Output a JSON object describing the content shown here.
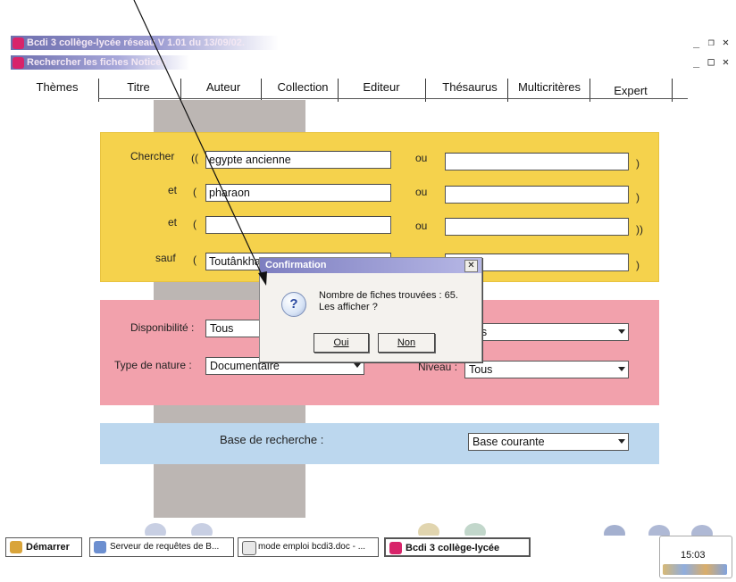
{
  "window": {
    "app_title": "Bcdi 3 collège-lycée réseau V 1.01 du 13/09/02.",
    "sub_title": "Rechercher les fiches Notices",
    "top_controls": "_ ❐ ✕",
    "sub_controls": "_ □ ✕"
  },
  "tabs": [
    "Thèmes",
    "Titre",
    "Auteur",
    "Collection",
    "Editeur",
    "Thésaurus",
    "Multicritères",
    "Expert"
  ],
  "search": {
    "rows": [
      {
        "label": "Chercher",
        "open": "((",
        "value": "egypte ancienne",
        "or_label": "ou",
        "or_value": "",
        "close": ")"
      },
      {
        "label": "et",
        "open": "(",
        "value": "pharaon",
        "or_label": "ou",
        "or_value": "",
        "close": ")"
      },
      {
        "label": "et",
        "open": "(",
        "value": "",
        "or_label": "ou",
        "or_value": "",
        "close": "))"
      },
      {
        "label": "sauf",
        "open": "(",
        "value": "Toutânkhar",
        "or_label": "ou",
        "or_value": "",
        "close": ")"
      }
    ]
  },
  "filters": {
    "availability_label": "Disponibilité :",
    "availability_value": "Tous",
    "right1_value": "ous",
    "nature_label": "Type de nature :",
    "nature_value": "Documentaire",
    "level_label": "Niveau :",
    "level_value": "Tous"
  },
  "base": {
    "label": "Base de recherche :",
    "value": "Base courante"
  },
  "dialog": {
    "title": "Confirmation",
    "close": "✕",
    "icon": "?",
    "line1": "Nombre de fiches trouvées :   65.",
    "line2": "Les afficher ?",
    "yes": "Oui",
    "no": "Non"
  },
  "taskbar": {
    "start": "Démarrer",
    "items": [
      "Serveur de requêtes de B...",
      "mode emploi bcdi3.doc - ...",
      "Bcdi 3 collège-lycée"
    ],
    "clock": "15:03"
  },
  "colors": {
    "yellow": "#f5d24c",
    "pink": "#f2a1ac",
    "blue": "#bcd7ee",
    "column": "#bcb6b3",
    "app_icon": "#d8246a"
  }
}
